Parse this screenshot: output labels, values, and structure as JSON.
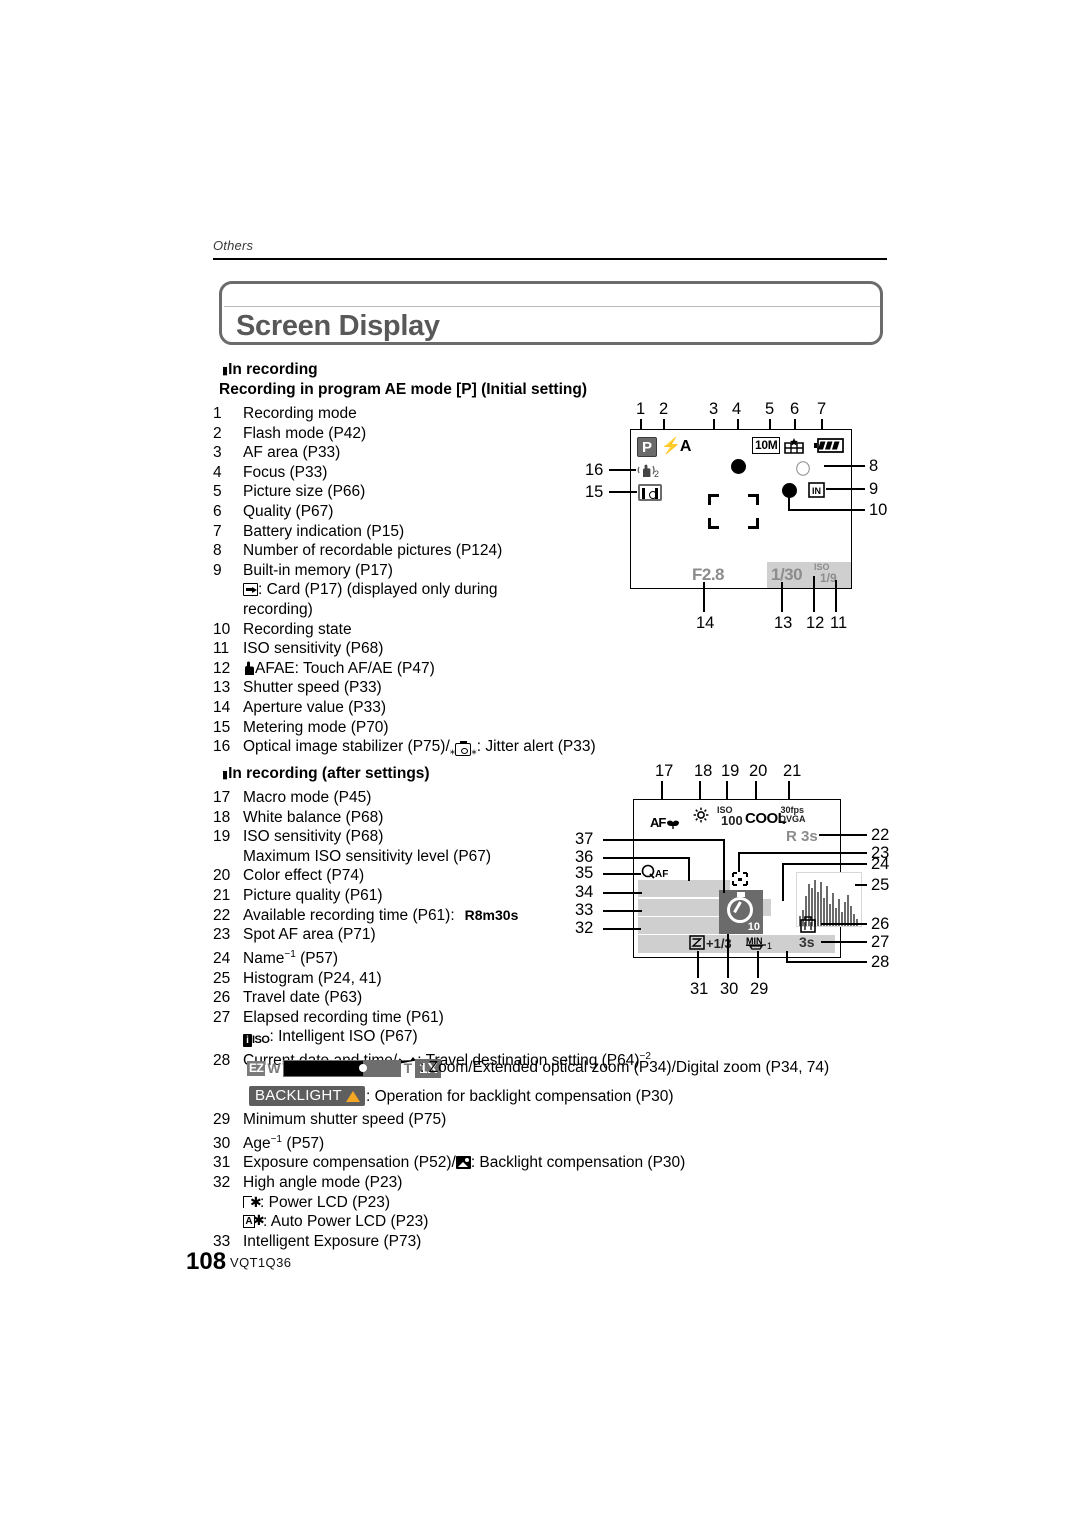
{
  "page": {
    "running_head": "Others",
    "title": "Screen Display",
    "page_number": "108",
    "doc_code": "VQT1Q36"
  },
  "section1": {
    "bullet": "∎",
    "heading": "In recording",
    "subheading": "Recording in program AE mode [P] (Initial setting)",
    "items": [
      {
        "n": "1",
        "text": "Recording mode"
      },
      {
        "n": "2",
        "text": "Flash mode (P42)"
      },
      {
        "n": "3",
        "text": "AF area (P33)"
      },
      {
        "n": "4",
        "text": "Focus (P33)"
      },
      {
        "n": "5",
        "text": "Picture size (P66)"
      },
      {
        "n": "6",
        "text": "Quality (P67)"
      },
      {
        "n": "7",
        "text": "Battery indication (P15)"
      },
      {
        "n": "8",
        "text": "Number of recordable pictures (P124)"
      },
      {
        "n": "9",
        "text": "Built-in memory (P17)"
      },
      {
        "n": "",
        "text": ": Card (P17) (displayed only during",
        "cont_icon": "card-icon"
      },
      {
        "n": "",
        "text": "recording)"
      },
      {
        "n": "10",
        "text": "Recording state"
      },
      {
        "n": "11",
        "text": "ISO sensitivity (P68)"
      },
      {
        "n": "12",
        "text": "AFAE: Touch AF/AE (P47)",
        "prefix_icon": "hand-icon"
      },
      {
        "n": "13",
        "text": "Shutter speed (P33)"
      },
      {
        "n": "14",
        "text": "Aperture value (P33)"
      },
      {
        "n": "15",
        "text": "Metering mode (P70)"
      },
      {
        "n": "16",
        "text": "Optical image stabilizer (P75)/",
        "suffix": ": Jitter alert (P33)",
        "suffix_icon": "jitter-icon"
      }
    ]
  },
  "section2": {
    "bullet": "∎",
    "heading": "In recording (after settings)",
    "items": [
      {
        "n": "17",
        "text": "Macro mode (P45)"
      },
      {
        "n": "18",
        "text": "White balance (P68)"
      },
      {
        "n": "19",
        "text": "ISO sensitivity (P68)"
      },
      {
        "n": "",
        "text": "Maximum ISO sensitivity level (P67)"
      },
      {
        "n": "20",
        "text": "Color effect (P74)"
      },
      {
        "n": "21",
        "text": "Picture quality (P61)"
      },
      {
        "n": "22",
        "text": "Available recording time (P61):",
        "value": "R8m30s"
      },
      {
        "n": "23",
        "text": "Spot AF area (P71)"
      },
      {
        "n": "24",
        "text": "Name",
        "sup": "−1",
        "after": "(P57)"
      },
      {
        "n": "25",
        "text": "Histogram (P24, 41)"
      },
      {
        "n": "26",
        "text": "Travel date (P63)"
      },
      {
        "n": "27",
        "text": "Elapsed recording time (P61)"
      },
      {
        "n": "",
        "text": ": Intelligent ISO (P67)",
        "prefix_icon": "intelligent-iso-icon"
      },
      {
        "n": "28",
        "text": "Current date and time/",
        "suffix": ": Travel destination setting (P64)",
        "sup2": "−2",
        "suffix_icon": "plane-icon"
      }
    ],
    "zoom_legend": {
      "ez": "EZ",
      "w": "W",
      "t": "T",
      "x": "1X",
      "text": ": Zoom/Extended optical zoom (P34)/Digital zoom (P34, 74)"
    },
    "backlight_legend": {
      "label": "BACKLIGHT",
      "text": ": Operation for backlight compensation (P30)"
    },
    "items_tail": [
      {
        "n": "29",
        "text": "Minimum shutter speed (P75)"
      },
      {
        "n": "30",
        "text": "Age",
        "sup": "−1",
        "after": "(P57)"
      },
      {
        "n": "31",
        "text": "Exposure compensation (P52)/",
        "suffix": ": Backlight compensation (P30)",
        "suffix_icon": "backlight-comp-icon"
      },
      {
        "n": "32",
        "text": "High angle mode (P23)"
      },
      {
        "n": "",
        "text": ":  Power LCD (P23)",
        "prefix_icon": "power-lcd-icon"
      },
      {
        "n": "",
        "text": ": Auto Power LCD (P23)",
        "prefix_icon": "auto-power-lcd-icon"
      },
      {
        "n": "33",
        "text": "Intelligent Exposure (P73)"
      }
    ]
  },
  "diagram1": {
    "callouts_top": [
      "1",
      "2",
      "3",
      "4",
      "5",
      "6",
      "7"
    ],
    "callouts_left": [
      "16",
      "15"
    ],
    "callouts_right": [
      "8",
      "9",
      "10"
    ],
    "callouts_bottom": [
      "14",
      "13",
      "12",
      "11"
    ],
    "screen_values": {
      "rec_mode": "P",
      "flash_mode": "A",
      "ois": "2",
      "picture_size": "10M",
      "aperture": "F2.8",
      "shutter": "1/30",
      "iso_label": "ISO",
      "iso_value": "1/9"
    }
  },
  "diagram2": {
    "callouts_top": [
      "17",
      "18",
      "19",
      "20",
      "21"
    ],
    "callouts_left": [
      "37",
      "36",
      "35",
      "34",
      "33",
      "32"
    ],
    "callouts_right": [
      "22",
      "23",
      "24",
      "25",
      "26",
      "27",
      "28"
    ],
    "callouts_bottom": [
      "31",
      "30",
      "29"
    ],
    "screen_values": {
      "macro": "AF",
      "iso_label": "ISO",
      "iso_value": "100",
      "color_effect": "COOL",
      "quality_fps": "30fps",
      "quality_size": "QVGA",
      "rec_time": "R 3s",
      "quick_af": "QAF",
      "exposure_comp": "+1/3",
      "min_shutter": "MIN",
      "min_shutter_val": "1",
      "elapsed": "3s",
      "timer_seconds": "10"
    }
  },
  "colors": {
    "title_gray": "#585858",
    "frame_gray": "#6b6b6b",
    "band_gray": "#cfcfcf",
    "accent_orange": "#f5a623"
  }
}
